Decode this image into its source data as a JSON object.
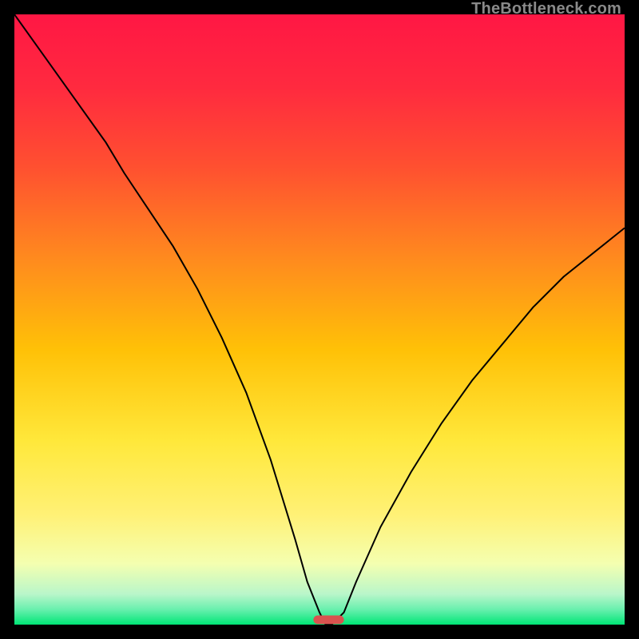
{
  "watermark": "TheBottleneck.com",
  "colors": {
    "frame": "#000000",
    "curve": "#000000",
    "pill_fill": "#d9534f",
    "gradient_stops": [
      {
        "offset": 0.0,
        "color": "#ff1744"
      },
      {
        "offset": 0.12,
        "color": "#ff2a3f"
      },
      {
        "offset": 0.25,
        "color": "#ff5030"
      },
      {
        "offset": 0.4,
        "color": "#ff8a1e"
      },
      {
        "offset": 0.55,
        "color": "#ffc107"
      },
      {
        "offset": 0.7,
        "color": "#ffe83b"
      },
      {
        "offset": 0.82,
        "color": "#fff176"
      },
      {
        "offset": 0.9,
        "color": "#f4ffb0"
      },
      {
        "offset": 0.95,
        "color": "#b9f6ca"
      },
      {
        "offset": 0.975,
        "color": "#69f0ae"
      },
      {
        "offset": 1.0,
        "color": "#00e676"
      }
    ]
  },
  "chart_data": {
    "type": "line",
    "title": "",
    "xlabel": "",
    "ylabel": "",
    "xlim": [
      0,
      100
    ],
    "ylim": [
      0,
      100
    ],
    "series": [
      {
        "name": "bottleneck-curve",
        "x": [
          0,
          5,
          10,
          15,
          18,
          22,
          26,
          30,
          34,
          38,
          42,
          46,
          48,
          50,
          51,
          52,
          54,
          56,
          60,
          65,
          70,
          75,
          80,
          85,
          90,
          95,
          100
        ],
        "y": [
          100,
          93,
          86,
          79,
          74,
          68,
          62,
          55,
          47,
          38,
          27,
          14,
          7,
          2,
          0,
          0,
          2,
          7,
          16,
          25,
          33,
          40,
          46,
          52,
          57,
          61,
          65
        ]
      }
    ],
    "annotations": [
      {
        "name": "optimum-pill",
        "x_center": 51.5,
        "y_center": 0.8,
        "width_pct": 5,
        "height_pct": 1.4
      }
    ]
  }
}
